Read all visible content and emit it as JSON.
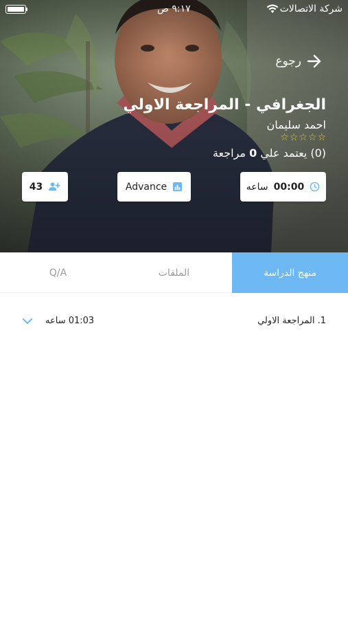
{
  "status_bar": {
    "carrier": "شركة الاتصالات",
    "time": "٩:١٧ ص"
  },
  "header": {
    "back_label": "رجوع",
    "back_icon": "arrow-right-icon"
  },
  "course": {
    "title": "الجغرافي - المراجعة الاولي",
    "instructor": "احمد سليمان",
    "rating_stars": 0,
    "rating_max": 5,
    "reviews_prefix": "(0) يعتمد علي ",
    "reviews_count": "0",
    "reviews_suffix": " مراجعة"
  },
  "stats": {
    "duration_value": "00:00",
    "duration_unit": "ساعه",
    "duration_icon": "clock-icon",
    "level": "Advance",
    "level_icon": "bar-chart-icon",
    "students": "43",
    "students_icon": "add-user-icon"
  },
  "tabs": [
    {
      "label": "منهج الدراسة",
      "active": true
    },
    {
      "label": "الملفات",
      "active": false
    },
    {
      "label": "Q/A",
      "active": false
    }
  ],
  "lessons": [
    {
      "title": "1. المراجعة الاولي",
      "duration": "01:03 ساعه",
      "expand_icon": "chevron-down-icon"
    }
  ],
  "colors": {
    "accent": "#6db8f2",
    "star": "#f3c623"
  }
}
